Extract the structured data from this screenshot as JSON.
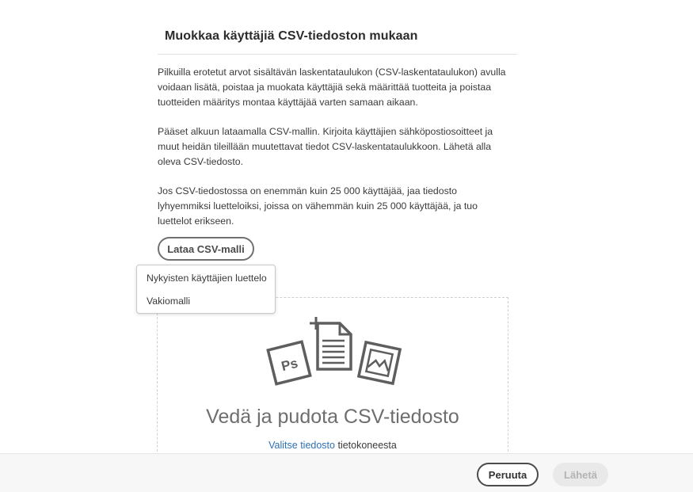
{
  "dialog": {
    "title": "Muokkaa käyttäjiä CSV-tiedoston mukaan",
    "paragraphs": [
      "Pilkuilla erotetut arvot sisältävän laskentataulukon (CSV-laskentataulukon) avulla voidaan lisätä, poistaa ja muokata käyttäjiä sekä määrittää tuotteita ja poistaa tuotteiden määritys montaa käyttäjää varten samaan aikaan.",
      "Pääset alkuun lataamalla CSV-mallin. Kirjoita käyttäjien sähköpostiosoitteet ja muut heidän tileillään muutettavat tiedot CSV-laskentataulukkoon. Lähetä alla oleva CSV-tiedosto.",
      "Jos CSV-tiedostossa on enemmän kuin 25 000 käyttäjää, jaa tiedosto lyhyemmiksi luetteloiksi, joissa on vähemmän kuin 25 000 käyttäjää, ja tuo luettelot erikseen."
    ],
    "download_button": "Lataa CSV-malli"
  },
  "dropdown": {
    "items": [
      "Nykyisten käyttäjien luettelo",
      "Vakiomalli"
    ]
  },
  "dropzone": {
    "title": "Vedä ja pudota CSV-tiedosto",
    "link_text": "Valitse tiedosto",
    "suffix_text": " tietokoneesta",
    "icons": [
      "photoshop-file-icon",
      "document-add-icon",
      "image-file-icon"
    ],
    "ps_label": "Ps"
  },
  "footer": {
    "cancel_label": "Peruuta",
    "send_label": "Lähetä"
  }
}
